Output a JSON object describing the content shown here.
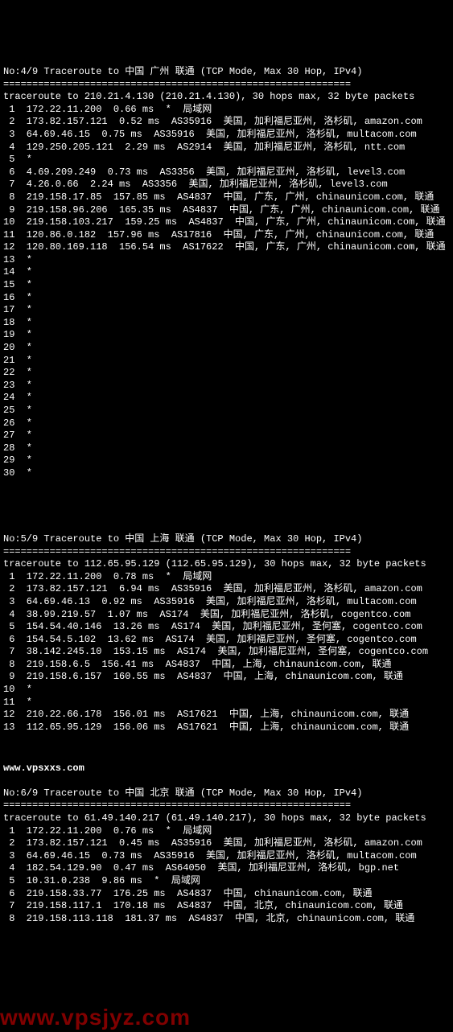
{
  "trace4": {
    "header": "No:4/9 Traceroute to 中国 广州 联通 (TCP Mode, Max 30 Hop, IPv4)",
    "divider": "============================================================",
    "cmd": "traceroute to 210.21.4.130 (210.21.4.130), 30 hops max, 32 byte packets",
    "hops": [
      " 1  172.22.11.200  0.66 ms  *  局域网",
      " 2  173.82.157.121  0.52 ms  AS35916  美国, 加利福尼亚州, 洛杉矶, amazon.com",
      " 3  64.69.46.15  0.75 ms  AS35916  美国, 加利福尼亚州, 洛杉矶, multacom.com",
      " 4  129.250.205.121  2.29 ms  AS2914  美国, 加利福尼亚州, 洛杉矶, ntt.com",
      " 5  *",
      " 6  4.69.209.249  0.73 ms  AS3356  美国, 加利福尼亚州, 洛杉矶, level3.com",
      " 7  4.26.0.66  2.24 ms  AS3356  美国, 加利福尼亚州, 洛杉矶, level3.com",
      " 8  219.158.17.85  157.85 ms  AS4837  中国, 广东, 广州, chinaunicom.com, 联通",
      " 9  219.158.96.206  165.35 ms  AS4837  中国, 广东, 广州, chinaunicom.com, 联通",
      "10  219.158.103.217  159.25 ms  AS4837  中国, 广东, 广州, chinaunicom.com, 联通",
      "11  120.86.0.182  157.96 ms  AS17816  中国, 广东, 广州, chinaunicom.com, 联通",
      "12  120.80.169.118  156.54 ms  AS17622  中国, 广东, 广州, chinaunicom.com, 联通",
      "13  *",
      "14  *",
      "15  *",
      "16  *",
      "17  *",
      "18  *",
      "19  *",
      "20  *",
      "21  *",
      "22  *",
      "23  *",
      "24  *",
      "25  *",
      "26  *",
      "27  *",
      "28  *",
      "29  *",
      "30  *"
    ]
  },
  "trace5": {
    "header": "No:5/9 Traceroute to 中国 上海 联通 (TCP Mode, Max 30 Hop, IPv4)",
    "divider": "============================================================",
    "cmd": "traceroute to 112.65.95.129 (112.65.95.129), 30 hops max, 32 byte packets",
    "hops": [
      " 1  172.22.11.200  0.78 ms  *  局域网",
      " 2  173.82.157.121  6.94 ms  AS35916  美国, 加利福尼亚州, 洛杉矶, amazon.com",
      " 3  64.69.46.13  0.92 ms  AS35916  美国, 加利福尼亚州, 洛杉矶, multacom.com",
      " 4  38.99.219.57  1.07 ms  AS174  美国, 加利福尼亚州, 洛杉矶, cogentco.com",
      " 5  154.54.40.146  13.26 ms  AS174  美国, 加利福尼亚州, 圣何塞, cogentco.com",
      " 6  154.54.5.102  13.62 ms  AS174  美国, 加利福尼亚州, 圣何塞, cogentco.com",
      " 7  38.142.245.10  153.15 ms  AS174  美国, 加利福尼亚州, 圣何塞, cogentco.com",
      " 8  219.158.6.5  156.41 ms  AS4837  中国, 上海, chinaunicom.com, 联通",
      " 9  219.158.6.157  160.55 ms  AS4837  中国, 上海, chinaunicom.com, 联通",
      "10  *",
      "11  *",
      "12  210.22.66.178  156.01 ms  AS17621  中国, 上海, chinaunicom.com, 联通",
      "13  112.65.95.129  156.06 ms  AS17621  中国, 上海, chinaunicom.com, 联通"
    ]
  },
  "siteurl": "www.vpsxxs.com",
  "trace6": {
    "header": "No:6/9 Traceroute to 中国 北京 联通 (TCP Mode, Max 30 Hop, IPv4)",
    "divider": "============================================================",
    "cmd": "traceroute to 61.49.140.217 (61.49.140.217), 30 hops max, 32 byte packets",
    "hops": [
      " 1  172.22.11.200  0.76 ms  *  局域网",
      " 2  173.82.157.121  0.45 ms  AS35916  美国, 加利福尼亚州, 洛杉矶, amazon.com",
      " 3  64.69.46.15  0.73 ms  AS35916  美国, 加利福尼亚州, 洛杉矶, multacom.com",
      " 4  182.54.129.90  0.47 ms  AS64050  美国, 加利福尼亚州, 洛杉矶, bgp.net",
      " 5  10.31.0.238  9.86 ms  *  局域网",
      " 6  219.158.33.77  176.25 ms  AS4837  中国, chinaunicom.com, 联通",
      " 7  219.158.117.1  170.18 ms  AS4837  中国, 北京, chinaunicom.com, 联通",
      " 8  219.158.113.118  181.37 ms  AS4837  中国, 北京, chinaunicom.com, 联通"
    ]
  },
  "watermark": "www.vpsjyz.com"
}
